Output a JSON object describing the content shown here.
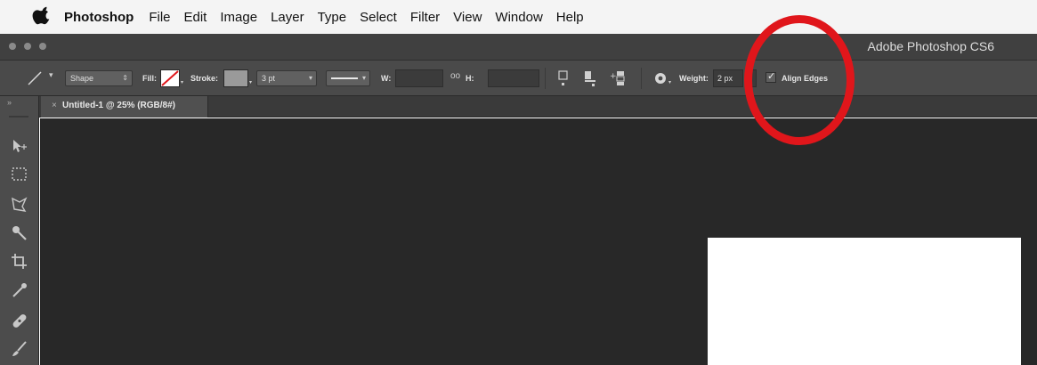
{
  "menubar": {
    "app_name": "Photoshop",
    "items": [
      "File",
      "Edit",
      "Image",
      "Layer",
      "Type",
      "Select",
      "Filter",
      "View",
      "Window",
      "Help"
    ]
  },
  "titlebar": {
    "title": "Adobe Photoshop CS6"
  },
  "options": {
    "mode": "Shape",
    "fill_label": "Fill:",
    "stroke_label": "Stroke:",
    "stroke_width": "3 pt",
    "w_label": "W:",
    "link_symbol": "oo",
    "h_label": "H:",
    "weight_label": "Weight:",
    "weight_value": "2 px",
    "align_edges_label": "Align Edges",
    "align_edges_checked": true
  },
  "document": {
    "tab_title": "Untitled-1 @ 25% (RGB/8#)"
  },
  "icons": {
    "tools": [
      "move-icon",
      "marquee-icon",
      "lasso-icon",
      "quick-selection-icon",
      "crop-icon",
      "eyedropper-icon",
      "healing-brush-icon",
      "brush-icon"
    ]
  },
  "colors": {
    "annotation": "#e0161b",
    "workspace": "#282828",
    "options_bar": "#4a4a4a"
  }
}
